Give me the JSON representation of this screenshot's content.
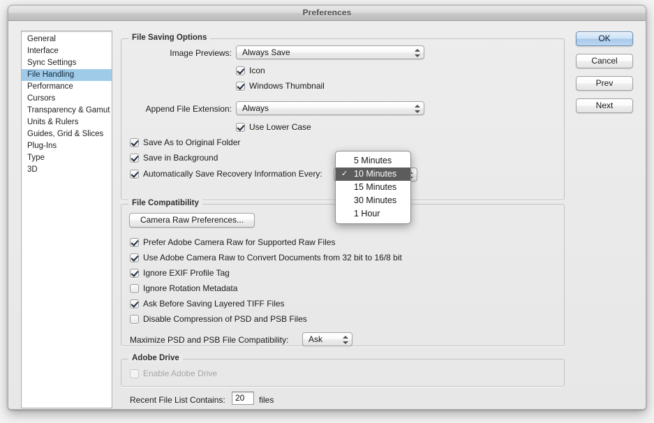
{
  "window": {
    "title": "Preferences"
  },
  "sidebar": {
    "items": [
      {
        "label": "General",
        "selected": false
      },
      {
        "label": "Interface",
        "selected": false
      },
      {
        "label": "Sync Settings",
        "selected": false
      },
      {
        "label": "File Handling",
        "selected": true
      },
      {
        "label": "Performance",
        "selected": false
      },
      {
        "label": "Cursors",
        "selected": false
      },
      {
        "label": "Transparency & Gamut",
        "selected": false
      },
      {
        "label": "Units & Rulers",
        "selected": false
      },
      {
        "label": "Guides, Grid & Slices",
        "selected": false
      },
      {
        "label": "Plug-Ins",
        "selected": false
      },
      {
        "label": "Type",
        "selected": false
      },
      {
        "label": "3D",
        "selected": false
      }
    ]
  },
  "buttons": {
    "ok": "OK",
    "cancel": "Cancel",
    "prev": "Prev",
    "next": "Next"
  },
  "file_saving_options": {
    "legend": "File Saving Options",
    "image_previews_label": "Image Previews:",
    "image_previews_value": "Always Save",
    "icon_label": "Icon",
    "windows_thumbnail_label": "Windows Thumbnail",
    "append_file_extension_label": "Append File Extension:",
    "append_file_extension_value": "Always",
    "use_lower_case_label": "Use Lower Case",
    "save_as_original_folder_label": "Save As to Original Folder",
    "save_in_background_label": "Save in Background",
    "auto_save_recovery_label": "Automatically Save Recovery Information Every:"
  },
  "recovery_menu": {
    "options": [
      {
        "label": "5 Minutes",
        "selected": false
      },
      {
        "label": "10 Minutes",
        "selected": true
      },
      {
        "label": "15 Minutes",
        "selected": false
      },
      {
        "label": "30 Minutes",
        "selected": false
      },
      {
        "label": "1 Hour",
        "selected": false
      }
    ]
  },
  "file_compatibility": {
    "legend": "File Compatibility",
    "camera_raw_button": "Camera Raw Preferences...",
    "prefer_camera_raw_label": "Prefer Adobe Camera Raw for Supported Raw Files",
    "convert_documents_label": "Use Adobe Camera Raw to Convert Documents from 32 bit to 16/8 bit",
    "ignore_exif_label": "Ignore EXIF Profile Tag",
    "ignore_rotation_label": "Ignore Rotation Metadata",
    "ask_before_saving_tiff_label": "Ask Before Saving Layered TIFF Files",
    "disable_compression_label": "Disable Compression of PSD and PSB Files",
    "maximize_label": "Maximize PSD and PSB File Compatibility:",
    "maximize_value": "Ask"
  },
  "adobe_drive": {
    "legend": "Adobe Drive",
    "enable_label": "Enable Adobe Drive"
  },
  "recent_files": {
    "label": "Recent File List Contains:",
    "value": "20",
    "suffix": "files"
  },
  "colors": {
    "selection_blue": "#9fcbe8",
    "menu_highlight": "#5c5c5c",
    "default_button_blue": "#a9c9eb"
  }
}
